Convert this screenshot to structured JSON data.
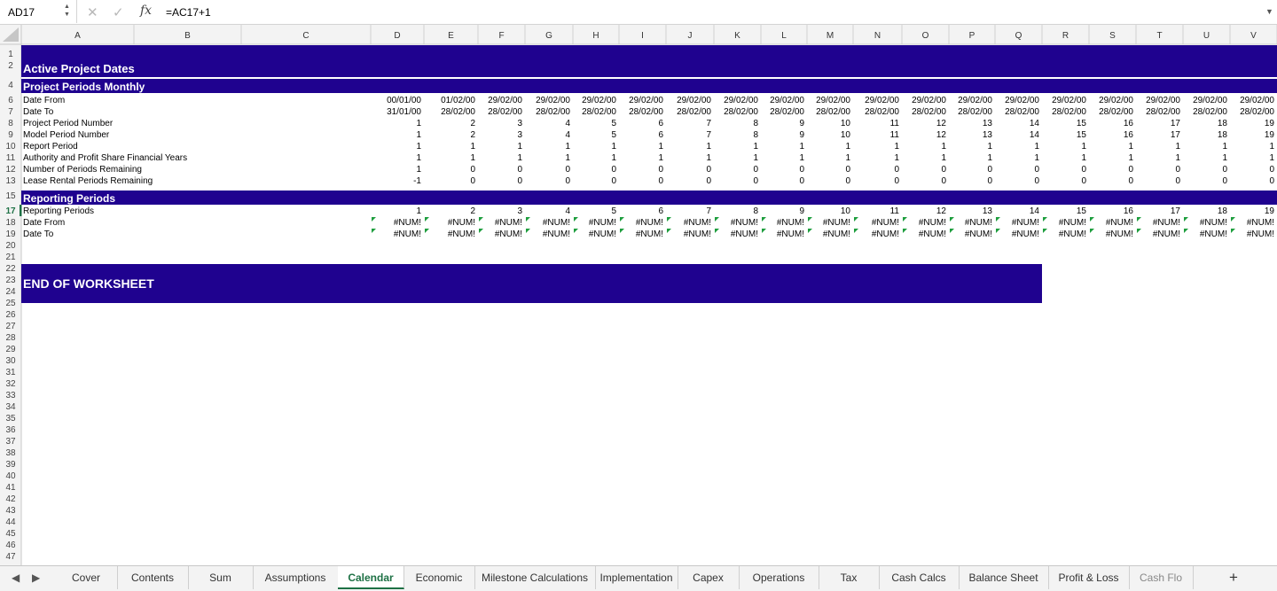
{
  "formula_bar": {
    "name_box": "AD17",
    "fx_label": "fx",
    "formula": "=AC17+1"
  },
  "columns": [
    "A",
    "B",
    "C",
    "D",
    "E",
    "F",
    "G",
    "H",
    "I",
    "J",
    "K",
    "L",
    "M",
    "N",
    "O",
    "P",
    "Q",
    "R",
    "S",
    "T",
    "U",
    "V"
  ],
  "data_columns": [
    "D",
    "E",
    "F",
    "G",
    "H",
    "I",
    "J",
    "K",
    "L",
    "M",
    "N",
    "O",
    "P",
    "Q",
    "R",
    "S",
    "T",
    "U",
    "V"
  ],
  "colors": {
    "header_band": "#1f028f",
    "header_text": "#ffffff",
    "grid_line": "#e2e2e2",
    "header_bg": "#f3f3f3",
    "selected_row": "#1e7145",
    "error_flag": "#1e9e3e"
  },
  "headers": {
    "active_project_dates": "Active Project Dates",
    "project_periods_monthly": "Project Periods Monthly",
    "reporting_periods": "Reporting Periods",
    "end_of_worksheet": "END OF WORKSHEET"
  },
  "monthly_rows": [
    {
      "row": "6",
      "label": "Date From",
      "values": [
        "00/01/00",
        "01/02/00",
        "29/02/00",
        "29/02/00",
        "29/02/00",
        "29/02/00",
        "29/02/00",
        "29/02/00",
        "29/02/00",
        "29/02/00",
        "29/02/00",
        "29/02/00",
        "29/02/00",
        "29/02/00",
        "29/02/00",
        "29/02/00",
        "29/02/00",
        "29/02/00",
        "29/02/00"
      ]
    },
    {
      "row": "7",
      "label": "Date To",
      "values": [
        "31/01/00",
        "28/02/00",
        "28/02/00",
        "28/02/00",
        "28/02/00",
        "28/02/00",
        "28/02/00",
        "28/02/00",
        "28/02/00",
        "28/02/00",
        "28/02/00",
        "28/02/00",
        "28/02/00",
        "28/02/00",
        "28/02/00",
        "28/02/00",
        "28/02/00",
        "28/02/00",
        "28/02/00"
      ]
    },
    {
      "row": "8",
      "label": "Project Period Number",
      "values": [
        "1",
        "2",
        "3",
        "4",
        "5",
        "6",
        "7",
        "8",
        "9",
        "10",
        "11",
        "12",
        "13",
        "14",
        "15",
        "16",
        "17",
        "18",
        "19"
      ]
    },
    {
      "row": "9",
      "label": "Model Period Number",
      "values": [
        "1",
        "2",
        "3",
        "4",
        "5",
        "6",
        "7",
        "8",
        "9",
        "10",
        "11",
        "12",
        "13",
        "14",
        "15",
        "16",
        "17",
        "18",
        "19"
      ]
    },
    {
      "row": "10",
      "label": "Report Period",
      "values": [
        "1",
        "1",
        "1",
        "1",
        "1",
        "1",
        "1",
        "1",
        "1",
        "1",
        "1",
        "1",
        "1",
        "1",
        "1",
        "1",
        "1",
        "1",
        "1"
      ]
    },
    {
      "row": "11",
      "label": "Authority and Profit Share Financial Years",
      "values": [
        "1",
        "1",
        "1",
        "1",
        "1",
        "1",
        "1",
        "1",
        "1",
        "1",
        "1",
        "1",
        "1",
        "1",
        "1",
        "1",
        "1",
        "1",
        "1"
      ]
    },
    {
      "row": "12",
      "label": "Number of Periods Remaining",
      "values": [
        "1",
        "0",
        "0",
        "0",
        "0",
        "0",
        "0",
        "0",
        "0",
        "0",
        "0",
        "0",
        "0",
        "0",
        "0",
        "0",
        "0",
        "0",
        "0"
      ]
    },
    {
      "row": "13",
      "label": "Lease Rental Periods Remaining",
      "values": [
        "-1",
        "0",
        "0",
        "0",
        "0",
        "0",
        "0",
        "0",
        "0",
        "0",
        "0",
        "0",
        "0",
        "0",
        "0",
        "0",
        "0",
        "0",
        "0"
      ]
    }
  ],
  "reporting_rows": [
    {
      "row": "17",
      "label": "Reporting Periods",
      "values": [
        "1",
        "2",
        "3",
        "4",
        "5",
        "6",
        "7",
        "8",
        "9",
        "10",
        "11",
        "12",
        "13",
        "14",
        "15",
        "16",
        "17",
        "18",
        "19"
      ],
      "error": false
    },
    {
      "row": "18",
      "label": "Date From",
      "values": [
        "#NUM!",
        "#NUM!",
        "#NUM!",
        "#NUM!",
        "#NUM!",
        "#NUM!",
        "#NUM!",
        "#NUM!",
        "#NUM!",
        "#NUM!",
        "#NUM!",
        "#NUM!",
        "#NUM!",
        "#NUM!",
        "#NUM!",
        "#NUM!",
        "#NUM!",
        "#NUM!",
        "#NUM!"
      ],
      "error": true
    },
    {
      "row": "19",
      "label": "Date To",
      "values": [
        "#NUM!",
        "#NUM!",
        "#NUM!",
        "#NUM!",
        "#NUM!",
        "#NUM!",
        "#NUM!",
        "#NUM!",
        "#NUM!",
        "#NUM!",
        "#NUM!",
        "#NUM!",
        "#NUM!",
        "#NUM!",
        "#NUM!",
        "#NUM!",
        "#NUM!",
        "#NUM!",
        "#NUM!"
      ],
      "error": true
    }
  ],
  "row_numbers": [
    "1",
    "2",
    "4",
    "6",
    "7",
    "8",
    "9",
    "10",
    "11",
    "12",
    "13",
    "15",
    "17",
    "18",
    "19",
    "20",
    "21",
    "22",
    "23",
    "24",
    "25",
    "26",
    "27",
    "28",
    "29",
    "30",
    "31",
    "32",
    "33",
    "34",
    "35",
    "36",
    "37",
    "38",
    "39",
    "40",
    "41",
    "42",
    "43",
    "44",
    "45",
    "46",
    "47"
  ],
  "selected_row": "17",
  "sheet_tabs": [
    "Cover",
    "Contents",
    "Sum",
    "Assumptions",
    "Calendar",
    "Economic",
    "Milestone Calculations",
    "Implementation",
    "Capex",
    "Operations",
    "Tax",
    "Cash Calcs",
    "Balance Sheet",
    "Profit & Loss",
    "Cash Flo"
  ],
  "active_tab": "Calendar",
  "add_sheet_label": "+"
}
